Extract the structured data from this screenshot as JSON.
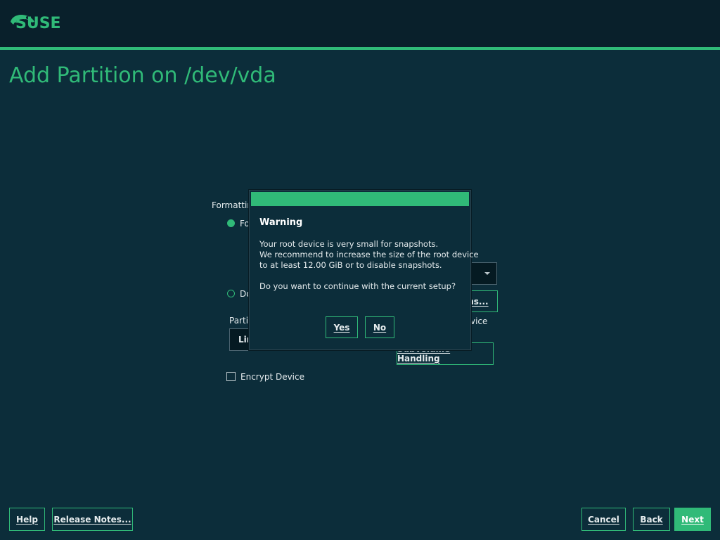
{
  "header": {
    "logo_text": "SUSE",
    "page_title": "Add Partition on /dev/vda"
  },
  "form": {
    "formatting_label": "Formattin",
    "format_radio_label": "Fo",
    "dont_format_radio_label": "Do",
    "partition_id_label": "Partit",
    "partition_id_value": "Lin",
    "mount_options_button": "ons...",
    "device_label_fragment": "vice",
    "subvolume_button": "Subvolume Handling",
    "encrypt_label": "Encrypt Device"
  },
  "dialog": {
    "title": "Warning",
    "line1": "Your root device is very small for snapshots.",
    "line2": "We recommend to increase the size of the root device",
    "line3": "to at least 12.00 GiB or to disable snapshots.",
    "question": "Do you want to continue with the current setup?",
    "yes_label": "Yes",
    "no_label": "No"
  },
  "footer": {
    "help_label": "Help",
    "release_notes_label": "Release Notes...",
    "cancel_label": "Cancel",
    "back_label": "Back",
    "next_label": "Next"
  },
  "colors": {
    "accent": "#30ba78",
    "background": "#0c2d3a",
    "header_bg": "#09202b"
  }
}
